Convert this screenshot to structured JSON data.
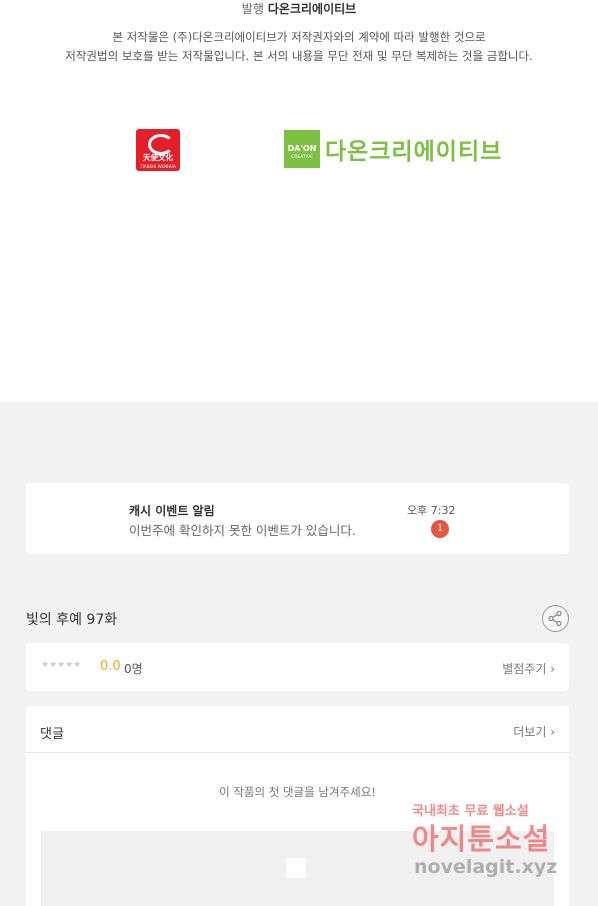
{
  "publisher": {
    "label": "발행",
    "name": "다온크리에이티브"
  },
  "copyright": {
    "line1": "본 저작물은 (주)다온크리에이티브가 저작권자와의 계약에 따라 발행한 것으로",
    "line2": "저작권법의 보호를 받는 저작물입니다. 본 서의 내용을 무단 전재 및 무단 복제하는 것을 금합니다."
  },
  "logos": {
    "logo1": {
      "text": "天使文化",
      "sub": "TIANSHI WENHUA"
    },
    "logo2": {
      "mark": "DA'ON",
      "mark_sub": "CREATIVE",
      "name": "다온크리에이티브"
    }
  },
  "notice": {
    "title": "캐시 이벤트 알림",
    "message": "이번주에 확인하지 못한 이벤트가 있습니다.",
    "time": "오후 7:32",
    "badge": "1"
  },
  "episode": {
    "title": "빛의 후예 97화"
  },
  "rating": {
    "stars": "★★★★★",
    "score": "0.0",
    "count": "0명",
    "rate_label": "별점주기 ›"
  },
  "comments": {
    "header": "댓글",
    "more_label": "더보기 ›",
    "empty_message": "이 작품의 첫 댓글을 남겨주세요!"
  },
  "watermark": {
    "line1": "국내최초 무료 웹소설",
    "line2": "아지툰소설",
    "line3": "novelagit.xyz"
  }
}
